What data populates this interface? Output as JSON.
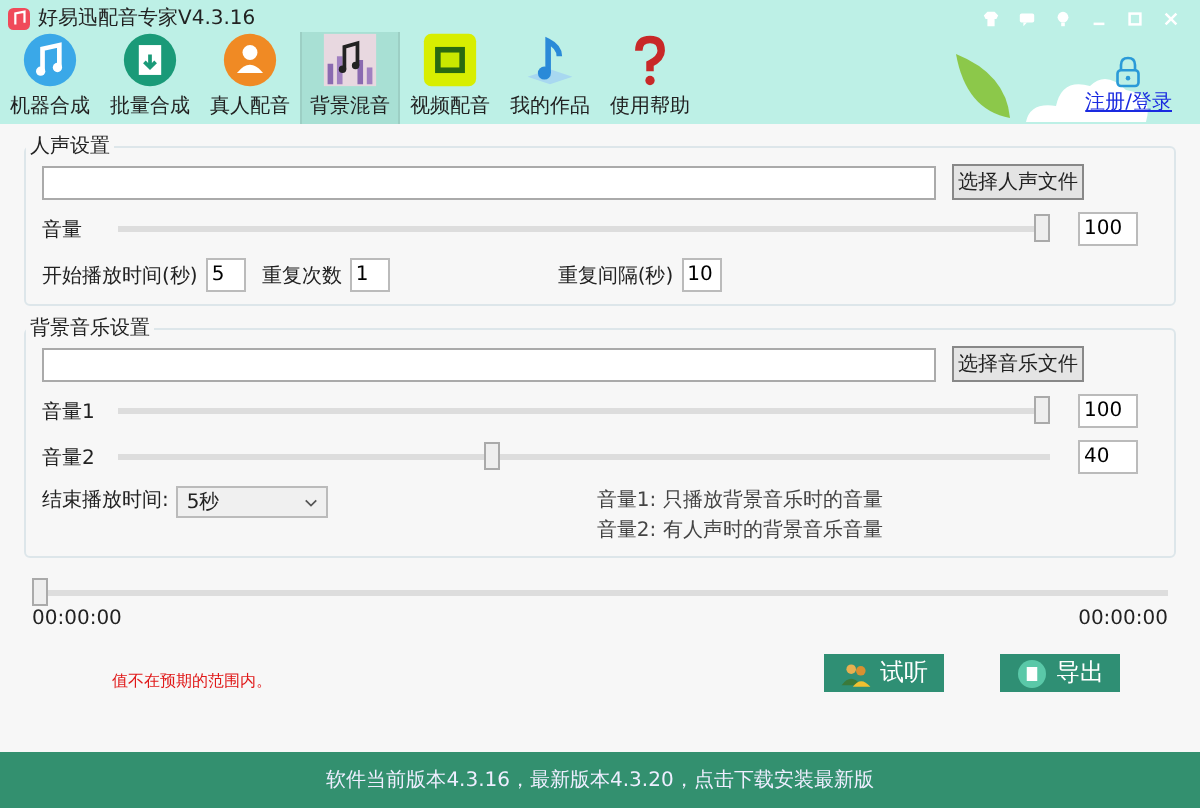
{
  "window": {
    "title": "好易迅配音专家V4.3.16"
  },
  "toolbar": [
    {
      "label": "机器合成",
      "selected": false
    },
    {
      "label": "批量合成",
      "selected": false
    },
    {
      "label": "真人配音",
      "selected": false
    },
    {
      "label": "背景混音",
      "selected": true
    },
    {
      "label": "视频配音",
      "selected": false
    },
    {
      "label": "我的作品",
      "selected": false
    },
    {
      "label": "使用帮助",
      "selected": false
    }
  ],
  "login_link": "注册/登录",
  "voice_settings": {
    "title": "人声设置",
    "file_button": "选择人声文件",
    "volume_label": "音量",
    "volume": {
      "level": 1.0
    },
    "volume_value": "100",
    "start_label": "开始播放时间(秒)",
    "start_value": "5",
    "repeat_label": "重复次数",
    "repeat_value": "1",
    "interval_label": "重复间隔(秒)",
    "interval_value": "10"
  },
  "music_settings": {
    "title": "背景音乐设置",
    "file_button": "选择音乐文件",
    "volume1_label": "音量1",
    "volume1": {
      "level": 1.0
    },
    "volume1_value": "100",
    "volume2_label": "音量2",
    "volume2": {
      "level": 0.4
    },
    "volume2_value": "40",
    "end_label": "结束播放时间:",
    "end_value": "5秒",
    "notes": [
      "音量1:  只播放背景音乐时的音量",
      "音量2:  有人声时的背景音乐音量"
    ]
  },
  "playback": {
    "progress": {
      "level": 0
    },
    "current_time": "00:00:00",
    "total_time": "00:00:00"
  },
  "error_message": "值不在预期的范围内。",
  "buttons": [
    "试听",
    "导出"
  ],
  "status_bar": "软件当前版本4.3.16，最新版本4.3.20，点击下载安装最新版"
}
